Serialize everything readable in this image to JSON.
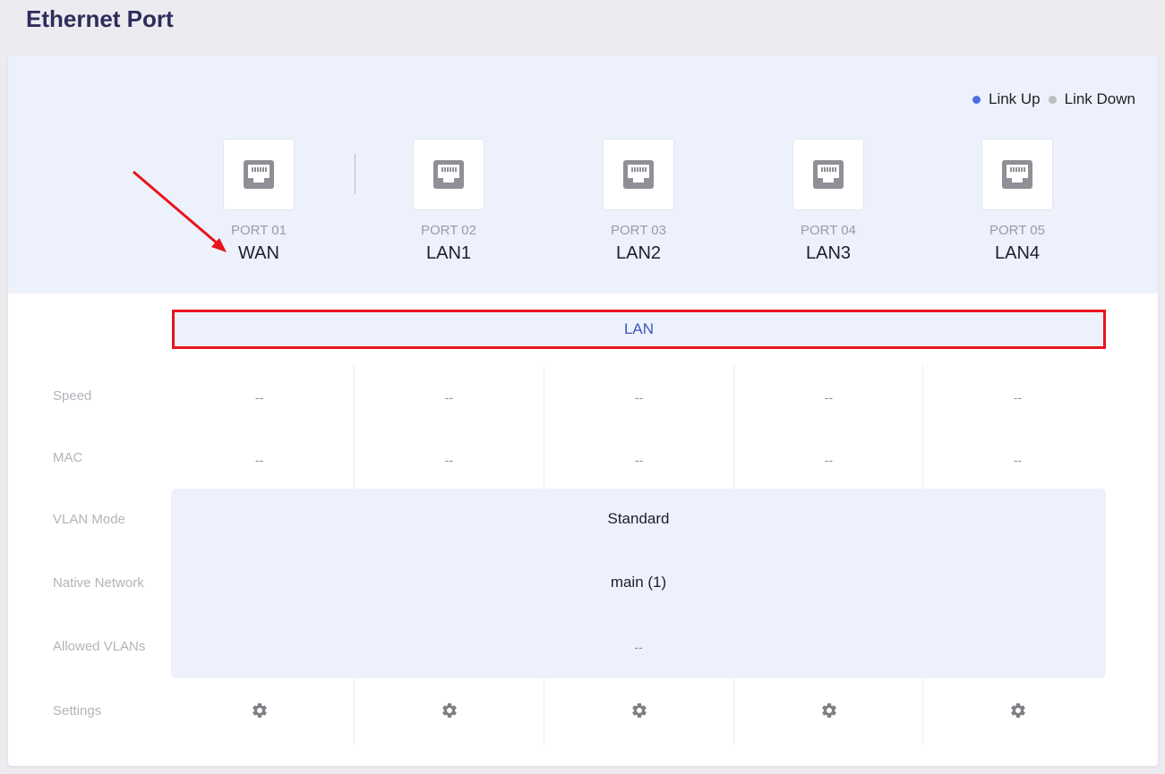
{
  "page": {
    "title": "Ethernet Port"
  },
  "legend": {
    "link_up": "Link Up",
    "link_down": "Link Down",
    "link_up_color": "#4a6ee0",
    "link_down_color": "#bdbdc2"
  },
  "ports": [
    {
      "num": "PORT 01",
      "name": "WAN"
    },
    {
      "num": "PORT 02",
      "name": "LAN1"
    },
    {
      "num": "PORT 03",
      "name": "LAN2"
    },
    {
      "num": "PORT 04",
      "name": "LAN3"
    },
    {
      "num": "PORT 05",
      "name": "LAN4"
    }
  ],
  "lan_group": {
    "label": "LAN"
  },
  "rows": {
    "speed": {
      "label": "Speed",
      "values": [
        "--",
        "--",
        "--",
        "--",
        "--"
      ]
    },
    "mac": {
      "label": "MAC",
      "values": [
        "--",
        "--",
        "--",
        "--",
        "--"
      ]
    },
    "vlan_mode": {
      "label": "VLAN Mode",
      "value": "Standard"
    },
    "native_network": {
      "label": "Native Network",
      "value": "main (1)"
    },
    "allowed_vlans": {
      "label": "Allowed VLANs",
      "value": "--"
    },
    "settings": {
      "label": "Settings"
    }
  },
  "annotation_colors": {
    "arrow": "#e8141c",
    "highlight_box": "#e8141c"
  }
}
